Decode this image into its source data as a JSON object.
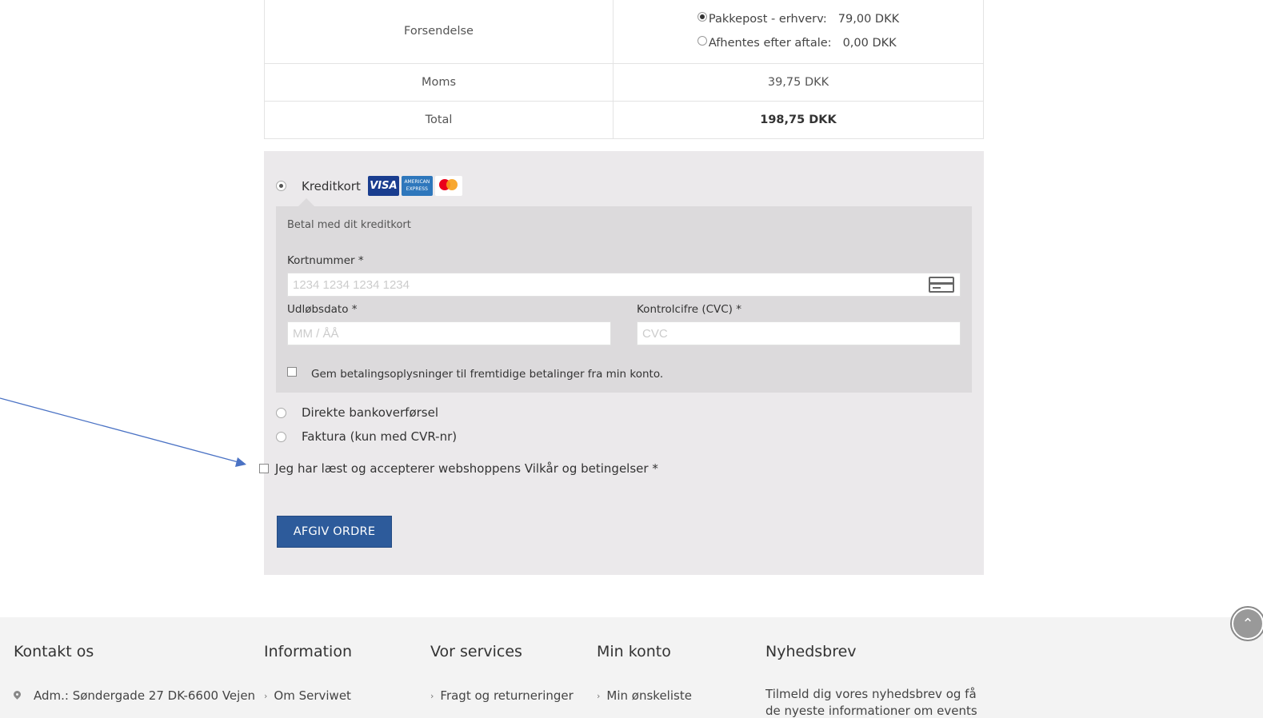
{
  "order": {
    "shipping_label": "Forsendelse",
    "shipping_options": [
      {
        "label": "Pakkepost - erhverv:",
        "price": "79,00 DKK",
        "selected": true
      },
      {
        "label": "Afhentes efter aftale:",
        "price": "0,00 DKK",
        "selected": false
      }
    ],
    "vat_label": "Moms",
    "vat_value": "39,75 DKK",
    "total_label": "Total",
    "total_value": "198,75 DKK"
  },
  "payment": {
    "credit_card_label": "Kreditkort",
    "card_logos": [
      "VISA",
      "AMERICAN EXPRESS",
      "mastercard"
    ],
    "card_description": "Betal med dit kreditkort",
    "card_number_label": "Kortnummer *",
    "card_number_placeholder": "1234 1234 1234 1234",
    "expiry_label": "Udløbsdato *",
    "expiry_placeholder": "MM / ÅÅ",
    "cvc_label": "Kontrolcifre (CVC) *",
    "cvc_placeholder": "CVC",
    "save_payment_label": "Gem betalingsoplysninger til fremtidige betalinger fra min konto.",
    "bank_transfer_label": "Direkte bankoverførsel",
    "invoice_label": "Faktura (kun med CVR-nr)",
    "terms_label": "Jeg har læst og accepterer webshoppens Vilkår og betingelser *",
    "submit_label": "AFGIV ORDRE"
  },
  "footer": {
    "contact_heading": "Kontakt os",
    "contact_address": "Adm.: Søndergade 27 DK-6600 Vejen",
    "info_heading": "Information",
    "info_link": "Om Serviwet",
    "services_heading": "Vor services",
    "services_link": "Fragt og returneringer",
    "account_heading": "Min konto",
    "account_link": "Min ønskeliste",
    "newsletter_heading": "Nyhedsbrev",
    "newsletter_text": "Tilmeld dig vores nyhedsbrev og få de nyeste informationer om events"
  },
  "colors": {
    "button_blue": "#2d5b9b",
    "arrow_blue": "#4a72c4",
    "panel_gray": "#ebe9eb"
  }
}
